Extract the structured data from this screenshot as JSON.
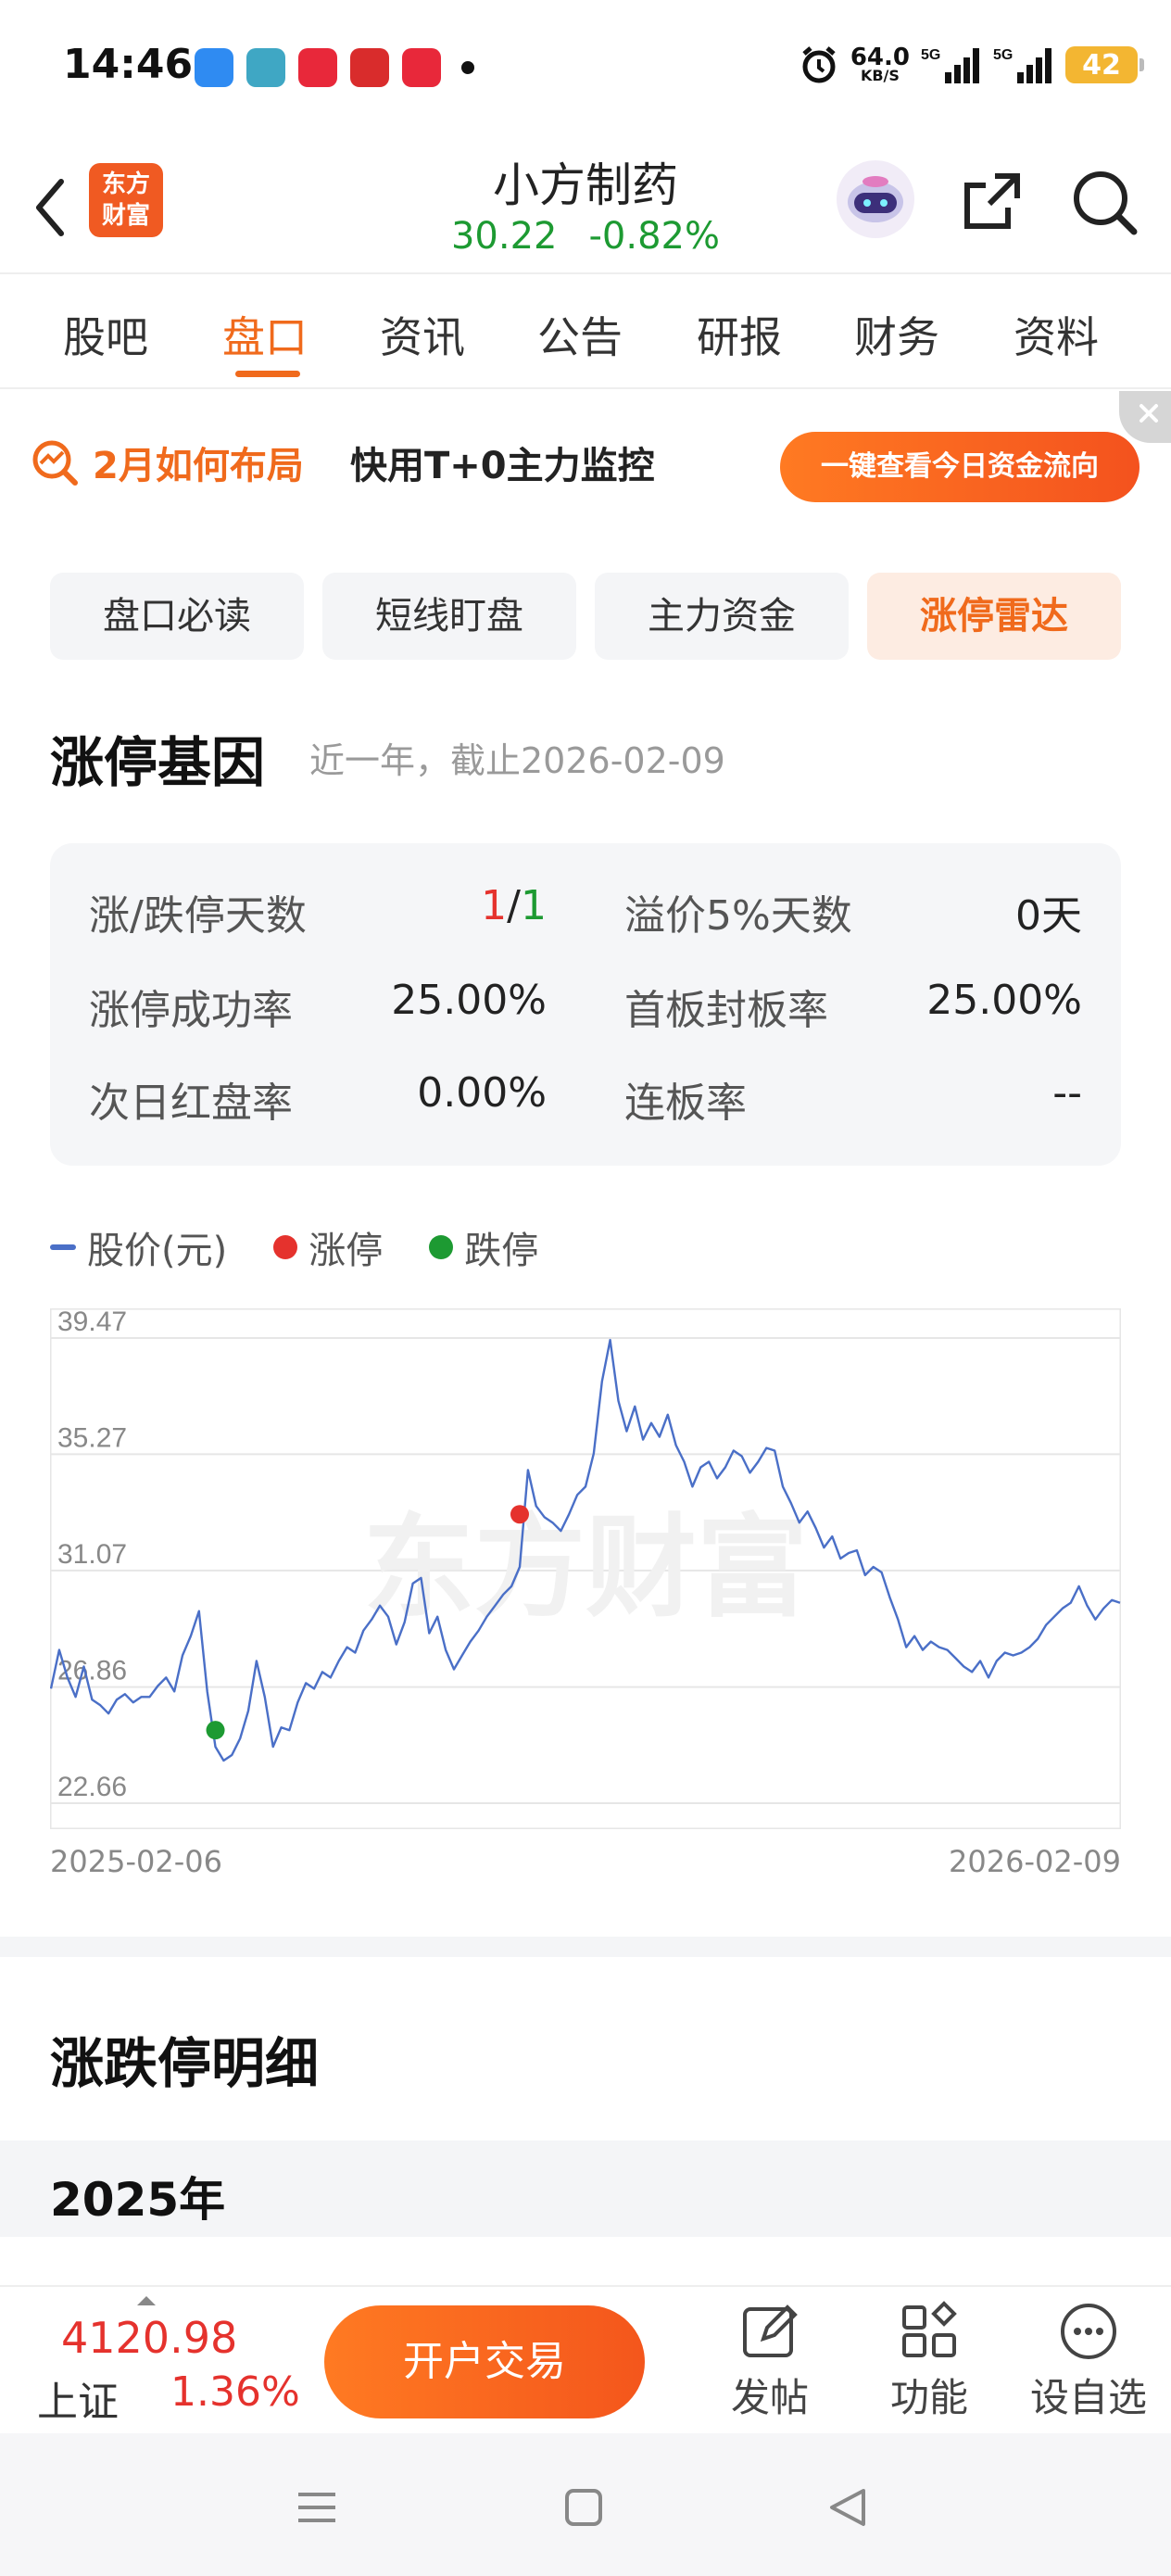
{
  "status_bar": {
    "time": "14:46",
    "speed_value": "64.0",
    "speed_unit": "KB/S",
    "signal_1": "5G",
    "signal_2": "5G",
    "battery": "42"
  },
  "header": {
    "logo_text_1": "东方",
    "logo_text_2": "财富",
    "stock_name": "小方制药",
    "price": "30.22",
    "change_pct": "-0.82%",
    "quote_color": "#1d9a32",
    "icons": [
      "back-icon",
      "robot-avatar-icon",
      "share-icon",
      "search-icon"
    ]
  },
  "tabs": [
    {
      "label": "股吧",
      "active": false
    },
    {
      "label": "盘口",
      "active": true
    },
    {
      "label": "资讯",
      "active": false
    },
    {
      "label": "公告",
      "active": false
    },
    {
      "label": "研报",
      "active": false
    },
    {
      "label": "财务",
      "active": false
    },
    {
      "label": "资料",
      "active": false
    }
  ],
  "promo": {
    "title": "2月如何布局",
    "subtitle": "快用T+0主力监控",
    "cta": "一键查看今日资金流向"
  },
  "chips": [
    {
      "label": "盘口必读",
      "active": false
    },
    {
      "label": "短线盯盘",
      "active": false
    },
    {
      "label": "主力资金",
      "active": false
    },
    {
      "label": "涨停雷达",
      "active": true
    }
  ],
  "gene": {
    "title": "涨停基因",
    "note": "近一年，截止2026-02-09",
    "stats": {
      "limit_days_label": "涨/跌停天数",
      "limit_up_count": "1",
      "slash": "/",
      "limit_down_count": "1",
      "premium_label": "溢价5%天数",
      "premium_value": "0天",
      "success_label": "涨停成功率",
      "success_value": "25.00%",
      "first_board_label": "首板封板率",
      "first_board_value": "25.00%",
      "next_day_label": "次日红盘率",
      "next_day_value": "0.00%",
      "consecutive_label": "连板率",
      "consecutive_value": "--"
    }
  },
  "legend": {
    "price": "股价(元)",
    "limit_up": "涨停",
    "limit_down": "跌停",
    "colors": {
      "price": "#4a6fc7",
      "limit_up": "#e5322d",
      "limit_down": "#1d9a32"
    }
  },
  "chart_data": {
    "type": "line",
    "title": "",
    "xlabel": "",
    "ylabel": "",
    "x_start": "2025-02-06",
    "x_end": "2026-02-09",
    "y_ticks": [
      "39.47",
      "35.27",
      "31.07",
      "26.86",
      "22.66"
    ],
    "ylim": [
      22.66,
      39.47
    ],
    "grid": true,
    "watermark": "东方财富",
    "series": [
      {
        "values": [
          26.8,
          28.2,
          27.2,
          26.5,
          27.6,
          26.4,
          26.2,
          25.9,
          26.4,
          26.6,
          26.3,
          26.5,
          26.5,
          26.9,
          27.2,
          26.7,
          28.0,
          28.7,
          29.6,
          26.7,
          24.7,
          24.2,
          24.4,
          25.0,
          26.0,
          27.8,
          26.5,
          24.7,
          25.4,
          25.3,
          26.3,
          27.0,
          26.8,
          27.4,
          27.2,
          27.8,
          28.3,
          28.1,
          28.9,
          29.3,
          29.8,
          29.4,
          28.4,
          29.2,
          30.6,
          30.8,
          28.8,
          29.4,
          28.2,
          27.5,
          28.0,
          28.5,
          28.9,
          29.4,
          29.8,
          30.2,
          30.5,
          31.2,
          34.7,
          33.4,
          33.0,
          32.8,
          32.5,
          33.1,
          33.8,
          34.1,
          35.3,
          37.9,
          39.4,
          37.2,
          36.1,
          37.0,
          35.8,
          36.4,
          35.9,
          36.7,
          35.6,
          35.0,
          34.1,
          34.8,
          35.0,
          34.4,
          34.8,
          35.4,
          35.2,
          34.6,
          35.0,
          35.5,
          35.4,
          34.1,
          33.5,
          32.8,
          33.2,
          32.6,
          31.9,
          32.3,
          31.5,
          31.7,
          31.8,
          30.9,
          31.2,
          31.0,
          30.1,
          29.3,
          28.3,
          28.7,
          28.2,
          28.5,
          28.3,
          28.2,
          27.9,
          27.6,
          27.4,
          27.8,
          27.2,
          27.8,
          28.1,
          28.0,
          28.1,
          28.3,
          28.6,
          29.1,
          29.4,
          29.7,
          29.9,
          30.5,
          29.8,
          29.3,
          29.7,
          30.0,
          29.9
        ],
        "limit_up": {
          "x_index": 57,
          "value": 33.1
        },
        "limit_down": {
          "x_index": 20,
          "value": 25.3
        }
      }
    ]
  },
  "detail": {
    "title": "涨跌停明细",
    "year": "2025年"
  },
  "bottom_bar": {
    "index_value": "4120.98",
    "index_name": "上证",
    "index_pct": "1.36%",
    "trade_label": "开户交易",
    "post_label": "发帖",
    "function_label": "功能",
    "watchlist_label": "设自选"
  }
}
